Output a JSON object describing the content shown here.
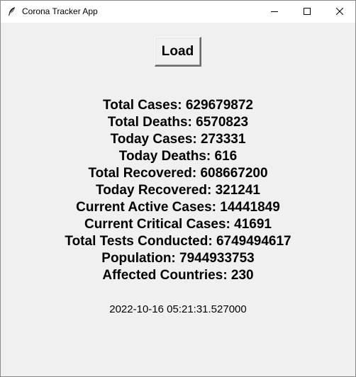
{
  "window": {
    "title": "Corona Tracker App",
    "icon": "feather-icon",
    "controls": [
      "minimize-icon",
      "maximize-icon",
      "close-icon"
    ]
  },
  "load_button": {
    "label": "Load"
  },
  "stats": [
    "Total Cases: 629679872",
    "Total Deaths: 6570823",
    "Today Cases: 273331",
    "Today Deaths: 616",
    "Total Recovered: 608667200",
    "Today Recovered: 321241",
    "Current Active Cases: 14441849",
    "Current Critical Cases: 41691",
    "Total Tests Conducted: 6749494617",
    "Population: 7944933753",
    "Affected Countries: 230"
  ],
  "timestamp": "2022-10-16 05:21:31.527000",
  "colors": {
    "window_background": "#f0f0f0",
    "titlebar_background": "#ffffff",
    "text": "#000000"
  }
}
